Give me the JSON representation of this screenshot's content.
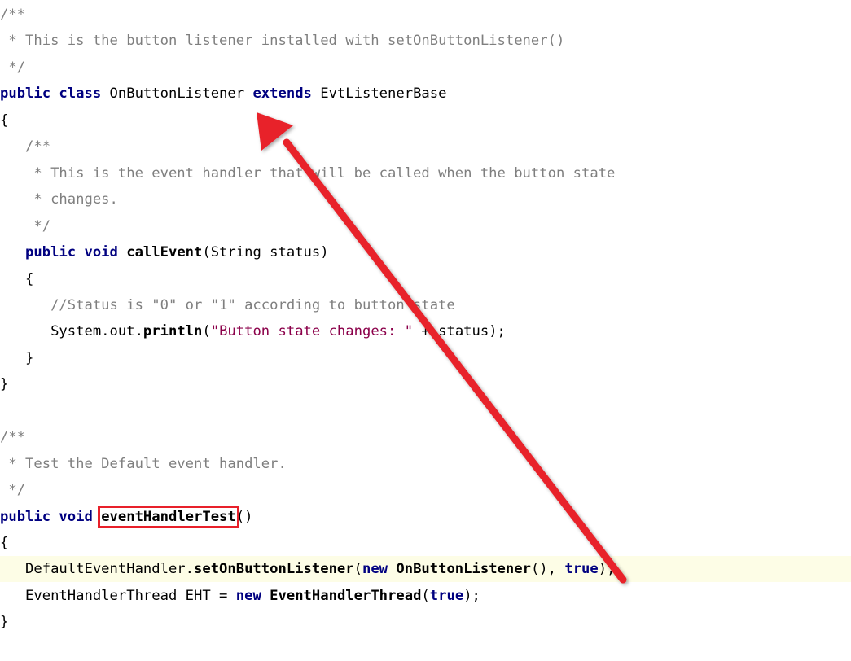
{
  "code_lines": [
    {
      "parts": [
        {
          "t": "/**",
          "c": "cm"
        }
      ]
    },
    {
      "parts": [
        {
          "t": " * This is the button listener installed with setOnButtonListener()",
          "c": "cm"
        }
      ]
    },
    {
      "parts": [
        {
          "t": " */",
          "c": "cm"
        }
      ]
    },
    {
      "parts": [
        {
          "t": "public class",
          "c": "kw"
        },
        {
          "t": " OnButtonListener ",
          "c": "plain"
        },
        {
          "t": "extends",
          "c": "kw"
        },
        {
          "t": " EvtListenerBase",
          "c": "plain"
        }
      ]
    },
    {
      "parts": [
        {
          "t": "{",
          "c": "plain"
        }
      ]
    },
    {
      "parts": [
        {
          "t": "   /**",
          "c": "cm"
        }
      ]
    },
    {
      "parts": [
        {
          "t": "    * This is the event handler that will be called when the button state",
          "c": "cm"
        }
      ]
    },
    {
      "parts": [
        {
          "t": "    * changes.",
          "c": "cm"
        }
      ]
    },
    {
      "parts": [
        {
          "t": "    */",
          "c": "cm"
        }
      ]
    },
    {
      "parts": [
        {
          "t": "   ",
          "c": "plain"
        },
        {
          "t": "public void",
          "c": "kw"
        },
        {
          "t": " ",
          "c": "plain"
        },
        {
          "t": "callEvent",
          "c": "mth"
        },
        {
          "t": "(String status)",
          "c": "plain"
        }
      ]
    },
    {
      "parts": [
        {
          "t": "   {",
          "c": "plain"
        }
      ]
    },
    {
      "parts": [
        {
          "t": "      //Status is \"0\" or \"1\" according to button state",
          "c": "cm"
        }
      ]
    },
    {
      "parts": [
        {
          "t": "      System.out.",
          "c": "plain"
        },
        {
          "t": "println",
          "c": "mth"
        },
        {
          "t": "(",
          "c": "plain"
        },
        {
          "t": "\"Button state changes: \"",
          "c": "str"
        },
        {
          "t": " + status);",
          "c": "plain"
        }
      ]
    },
    {
      "parts": [
        {
          "t": "   }",
          "c": "plain"
        }
      ]
    },
    {
      "parts": [
        {
          "t": "}",
          "c": "plain"
        }
      ]
    },
    {
      "parts": [
        {
          "t": "",
          "c": "plain"
        }
      ]
    },
    {
      "parts": [
        {
          "t": "/**",
          "c": "cm"
        }
      ]
    },
    {
      "parts": [
        {
          "t": " * Test the Default event handler.",
          "c": "cm"
        }
      ]
    },
    {
      "parts": [
        {
          "t": " */",
          "c": "cm"
        }
      ]
    },
    {
      "parts": [
        {
          "t": "public void",
          "c": "kw"
        },
        {
          "t": " ",
          "c": "plain"
        },
        {
          "t": "eventHandlerTest",
          "c": "mth",
          "box": true
        },
        {
          "t": "()",
          "c": "plain"
        }
      ]
    },
    {
      "parts": [
        {
          "t": "{",
          "c": "plain"
        }
      ]
    },
    {
      "highlight": true,
      "parts": [
        {
          "t": "   DefaultEventHandler.",
          "c": "plain"
        },
        {
          "t": "setOnButtonListener",
          "c": "mth"
        },
        {
          "t": "(",
          "c": "plain"
        },
        {
          "t": "new",
          "c": "kw"
        },
        {
          "t": " ",
          "c": "plain"
        },
        {
          "t": "OnButtonListener",
          "c": "mth"
        },
        {
          "t": "(), ",
          "c": "plain"
        },
        {
          "t": "true",
          "c": "kw"
        },
        {
          "t": ");",
          "c": "plain"
        }
      ]
    },
    {
      "parts": [
        {
          "t": "   EventHandlerThread EHT = ",
          "c": "plain"
        },
        {
          "t": "new",
          "c": "kw"
        },
        {
          "t": " ",
          "c": "plain"
        },
        {
          "t": "EventHandlerThread",
          "c": "mth"
        },
        {
          "t": "(",
          "c": "plain"
        },
        {
          "t": "true",
          "c": "kw"
        },
        {
          "t": ");",
          "c": "plain"
        }
      ]
    },
    {
      "parts": [
        {
          "t": "}",
          "c": "plain"
        }
      ]
    }
  ],
  "annotation": {
    "arrow_color": "#e8202a",
    "box_color": "#e8202a"
  }
}
